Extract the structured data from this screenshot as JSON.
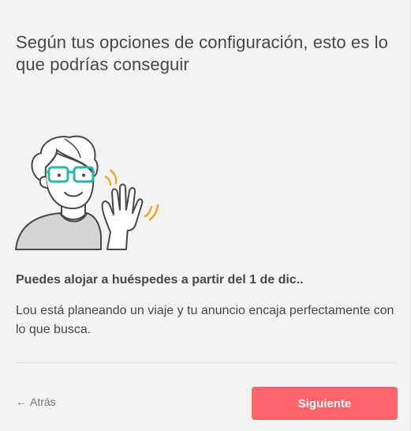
{
  "header": {
    "title": "Según tus opciones de configuración, esto es lo que podrías conseguir"
  },
  "content": {
    "illustration_icon": "person-waving-icon",
    "headline": "Puedes alojar a huéspedes a partir del 1 de dic..",
    "description": "Lou está planeando un viaje y tu anuncio encaja perfectamente con lo que busca."
  },
  "footer": {
    "back_arrow_icon": "arrow-left-icon",
    "back_label": "Atrás",
    "next_label": "Siguiente"
  },
  "colors": {
    "primary": "#ff5a5f",
    "glasses": "#2bb5a5",
    "motion_lines": "#f5a623",
    "text": "#484848"
  }
}
